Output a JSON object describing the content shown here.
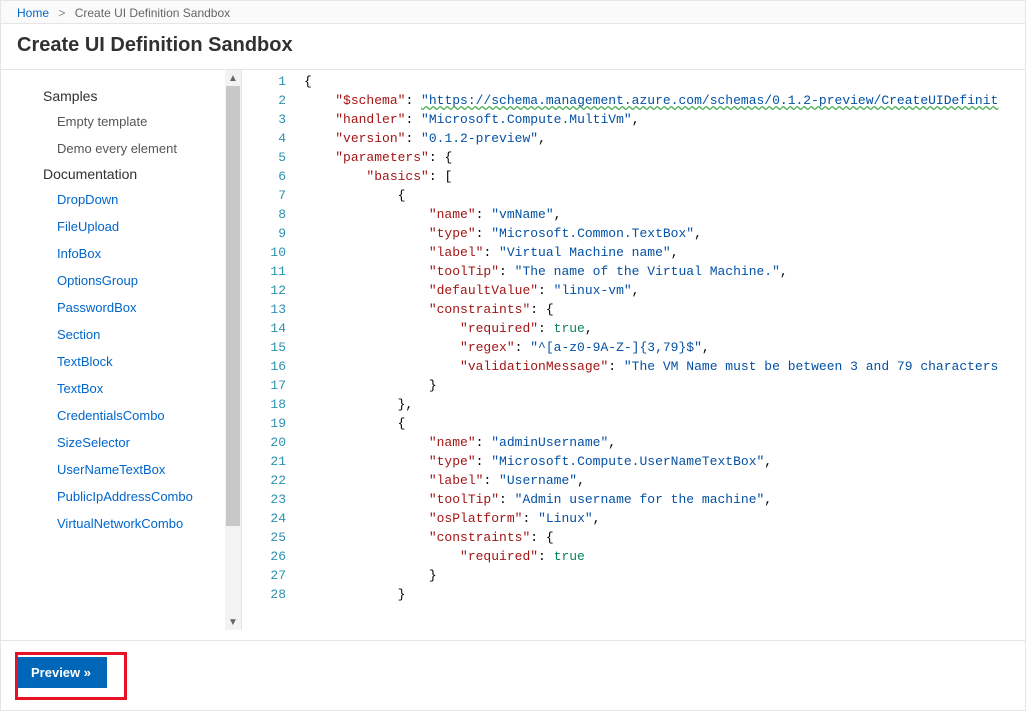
{
  "breadcrumb": {
    "home": "Home",
    "current": "Create UI Definition Sandbox"
  },
  "title": "Create UI Definition Sandbox",
  "sidebar": {
    "groups": [
      {
        "header": "Samples",
        "items": [
          {
            "label": "Empty template",
            "link": false
          },
          {
            "label": "Demo every element",
            "link": false
          }
        ]
      },
      {
        "header": "Documentation",
        "items": [
          {
            "label": "DropDown",
            "link": true
          },
          {
            "label": "FileUpload",
            "link": true
          },
          {
            "label": "InfoBox",
            "link": true
          },
          {
            "label": "OptionsGroup",
            "link": true
          },
          {
            "label": "PasswordBox",
            "link": true
          },
          {
            "label": "Section",
            "link": true
          },
          {
            "label": "TextBlock",
            "link": true
          },
          {
            "label": "TextBox",
            "link": true
          },
          {
            "label": "CredentialsCombo",
            "link": true
          },
          {
            "label": "SizeSelector",
            "link": true
          },
          {
            "label": "UserNameTextBox",
            "link": true
          },
          {
            "label": "PublicIpAddressCombo",
            "link": true
          },
          {
            "label": "VirtualNetworkCombo",
            "link": true
          }
        ]
      }
    ]
  },
  "editor": {
    "lines": [
      {
        "n": 1,
        "html": "<span class='p'>{</span>"
      },
      {
        "n": 2,
        "html": "    <span class='k'>\"$schema\"</span><span class='p'>: </span><span class='u'>\"https://schema.management.azure.com/schemas/0.1.2-preview/CreateUIDefinit</span>"
      },
      {
        "n": 3,
        "html": "    <span class='k'>\"handler\"</span><span class='p'>: </span><span class='s'>\"Microsoft.Compute.MultiVm\"</span><span class='p'>,</span>"
      },
      {
        "n": 4,
        "html": "    <span class='k'>\"version\"</span><span class='p'>: </span><span class='s'>\"0.1.2-preview\"</span><span class='p'>,</span>"
      },
      {
        "n": 5,
        "html": "    <span class='k'>\"parameters\"</span><span class='p'>: {</span>"
      },
      {
        "n": 6,
        "html": "        <span class='k'>\"basics\"</span><span class='p'>: [</span>"
      },
      {
        "n": 7,
        "html": "            <span class='p'>{</span>"
      },
      {
        "n": 8,
        "html": "                <span class='k'>\"name\"</span><span class='p'>: </span><span class='s'>\"vmName\"</span><span class='p'>,</span>"
      },
      {
        "n": 9,
        "html": "                <span class='k'>\"type\"</span><span class='p'>: </span><span class='s'>\"Microsoft.Common.TextBox\"</span><span class='p'>,</span>"
      },
      {
        "n": 10,
        "html": "                <span class='k'>\"label\"</span><span class='p'>: </span><span class='s'>\"Virtual Machine name\"</span><span class='p'>,</span>"
      },
      {
        "n": 11,
        "html": "                <span class='k'>\"toolTip\"</span><span class='p'>: </span><span class='s'>\"The name of the Virtual Machine.\"</span><span class='p'>,</span>"
      },
      {
        "n": 12,
        "html": "                <span class='k'>\"defaultValue\"</span><span class='p'>: </span><span class='s'>\"linux-vm\"</span><span class='p'>,</span>"
      },
      {
        "n": 13,
        "html": "                <span class='k'>\"constraints\"</span><span class='p'>: {</span>"
      },
      {
        "n": 14,
        "html": "                    <span class='k'>\"required\"</span><span class='p'>: </span><span class='n'>true</span><span class='p'>,</span>"
      },
      {
        "n": 15,
        "html": "                    <span class='k'>\"regex\"</span><span class='p'>: </span><span class='s'>\"^[a-z0-9A-Z-]{3,79}$\"</span><span class='p'>,</span>"
      },
      {
        "n": 16,
        "html": "                    <span class='k'>\"validationMessage\"</span><span class='p'>: </span><span class='s'>\"The VM Name must be between 3 and 79 characters</span>"
      },
      {
        "n": 17,
        "html": "                <span class='p'>}</span>"
      },
      {
        "n": 18,
        "html": "            <span class='p'>},</span>"
      },
      {
        "n": 19,
        "html": "            <span class='p'>{</span>"
      },
      {
        "n": 20,
        "html": "                <span class='k'>\"name\"</span><span class='p'>: </span><span class='s'>\"adminUsername\"</span><span class='p'>,</span>"
      },
      {
        "n": 21,
        "html": "                <span class='k'>\"type\"</span><span class='p'>: </span><span class='s'>\"Microsoft.Compute.UserNameTextBox\"</span><span class='p'>,</span>"
      },
      {
        "n": 22,
        "html": "                <span class='k'>\"label\"</span><span class='p'>: </span><span class='s'>\"Username\"</span><span class='p'>,</span>"
      },
      {
        "n": 23,
        "html": "                <span class='k'>\"toolTip\"</span><span class='p'>: </span><span class='s'>\"Admin username for the machine\"</span><span class='p'>,</span>"
      },
      {
        "n": 24,
        "html": "                <span class='k'>\"osPlatform\"</span><span class='p'>: </span><span class='s'>\"Linux\"</span><span class='p'>,</span>"
      },
      {
        "n": 25,
        "html": "                <span class='k'>\"constraints\"</span><span class='p'>: {</span>"
      },
      {
        "n": 26,
        "html": "                    <span class='k'>\"required\"</span><span class='p'>: </span><span class='n'>true</span>"
      },
      {
        "n": 27,
        "html": "                <span class='p'>}</span>"
      },
      {
        "n": 28,
        "html": "            <span class='p'>}</span>"
      }
    ]
  },
  "footer": {
    "preview_label": "Preview »"
  }
}
